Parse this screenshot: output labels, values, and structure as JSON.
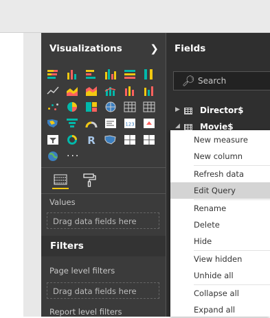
{
  "visualizations": {
    "title": "Visualizations",
    "values_label": "Values",
    "values_drop": "Drag data fields here",
    "more_label": "···"
  },
  "filters": {
    "title": "Filters",
    "page_level": "Page level filters",
    "page_drop": "Drag data fields here",
    "report_level": "Report level filters"
  },
  "fields": {
    "title": "Fields",
    "search_placeholder": "Search",
    "tables": [
      "Director$",
      "Movie$"
    ]
  },
  "context_menu": {
    "items": [
      "New measure",
      "New column",
      "Refresh data",
      "Edit Query",
      "Rename",
      "Delete",
      "Hide",
      "View hidden",
      "Unhide all",
      "Collapse all",
      "Expand all"
    ],
    "highlighted": "Edit Query"
  },
  "colors": {
    "accent": "#f2c811",
    "viz_blue": "#01b8aa",
    "viz_orange": "#fd625e"
  }
}
